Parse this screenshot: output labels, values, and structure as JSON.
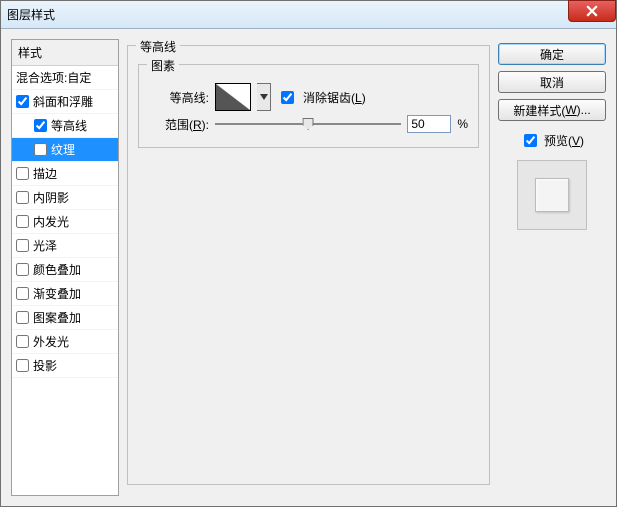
{
  "window": {
    "title": "图层样式"
  },
  "close": {
    "name": "close"
  },
  "styles_header": "样式",
  "styles": [
    {
      "label": "混合选项:自定",
      "checked": null,
      "sub": false,
      "selected": false
    },
    {
      "label": "斜面和浮雕",
      "checked": true,
      "sub": false,
      "selected": false
    },
    {
      "label": "等高线",
      "checked": true,
      "sub": true,
      "selected": false
    },
    {
      "label": "纹理",
      "checked": false,
      "sub": true,
      "selected": true
    },
    {
      "label": "描边",
      "checked": false,
      "sub": false,
      "selected": false
    },
    {
      "label": "内阴影",
      "checked": false,
      "sub": false,
      "selected": false
    },
    {
      "label": "内发光",
      "checked": false,
      "sub": false,
      "selected": false
    },
    {
      "label": "光泽",
      "checked": false,
      "sub": false,
      "selected": false
    },
    {
      "label": "颜色叠加",
      "checked": false,
      "sub": false,
      "selected": false
    },
    {
      "label": "渐变叠加",
      "checked": false,
      "sub": false,
      "selected": false
    },
    {
      "label": "图案叠加",
      "checked": false,
      "sub": false,
      "selected": false
    },
    {
      "label": "外发光",
      "checked": false,
      "sub": false,
      "selected": false
    },
    {
      "label": "投影",
      "checked": false,
      "sub": false,
      "selected": false
    }
  ],
  "panel": {
    "group_title": "等高线",
    "elements_title": "图素",
    "contour_label": "等高线:",
    "antialias_label": "消除锯齿(",
    "antialias_key": "L",
    "antialias_suffix": ")",
    "antialias_checked": true,
    "range_label": "范围(",
    "range_key": "R",
    "range_suffix": "):",
    "range_value": "50",
    "range_unit": "%"
  },
  "buttons": {
    "ok": "确定",
    "cancel": "取消",
    "new_style": "新建样式(",
    "new_style_key": "W",
    "new_style_suffix": ")...",
    "preview_label": "预览(",
    "preview_key": "V",
    "preview_suffix": ")",
    "preview_checked": true
  }
}
